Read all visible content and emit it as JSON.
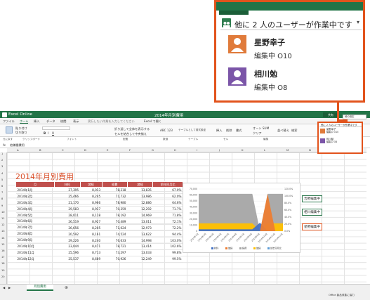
{
  "app": {
    "name": "Excel Online",
    "doc_title": "2014年月別費用",
    "tell_me": "実行したい作業を入力してください",
    "open_excel": "Excel で開く",
    "share": "共有"
  },
  "tabs": [
    "ファイル",
    "ホーム",
    "挿入",
    "データ",
    "校閲",
    "表示"
  ],
  "ribbon_groups": [
    "元に戻す",
    "クリップボード",
    "フォント",
    "配置",
    "数値",
    "テーブル",
    "セル",
    "編集"
  ],
  "ribbon_buttons": {
    "paste": "貼り付け",
    "cut": "切り取り",
    "copy": "コピー",
    "wrap": "折り返して全体を表示する",
    "merge": "セルを結合して中央揃え",
    "number": "ABC 123",
    "table_format": "テーブルとして書式設定",
    "insert": "挿入",
    "delete": "削除",
    "format": "書式",
    "autosum": "オート SUM",
    "clear": "クリア",
    "sort": "並べ替え",
    "find": "検索"
  },
  "formula_bar": {
    "fx": "fx",
    "content": "他職種費用"
  },
  "columns": [
    "A",
    "B",
    "C",
    "D",
    "E",
    "F",
    "G",
    "H",
    "I",
    "J",
    "K",
    "L",
    "M",
    "N",
    "O",
    "P",
    "Q"
  ],
  "rows": [
    "1",
    "2",
    "3",
    "4",
    "5",
    "6",
    "7",
    "8",
    "9",
    "10",
    "11",
    "12",
    "13",
    "14",
    "15",
    "16",
    "17",
    "18",
    "19",
    "20"
  ],
  "sheet": {
    "title": "2014年月別費用",
    "headers": [
      "月",
      "材料",
      "諸経",
      "経費",
      "諸経",
      "前年同月比"
    ],
    "rows": [
      [
        "2014年1月",
        "27,395",
        "8,013",
        "78,218",
        "13,835",
        "67.0%"
      ],
      [
        "2014年2月",
        "25,466",
        "8,245",
        "71,732",
        "13,986",
        "62.0%"
      ],
      [
        "2014年3月",
        "21,170",
        "8,966",
        "78,980",
        "12,886",
        "64.6%"
      ],
      [
        "2014年4月",
        "29,583",
        "8,937",
        "70,359",
        "12,292",
        "71.7%"
      ],
      [
        "2014年5月",
        "28,011",
        "8,118",
        "78,192",
        "14,969",
        "71.8%"
      ],
      [
        "2014年6月",
        "26,519",
        "8,927",
        "70,489",
        "13,011",
        "72.1%"
      ],
      [
        "2014年7月",
        "26,656",
        "8,205",
        "71,024",
        "12,973",
        "72.2%"
      ],
      [
        "2014年8月",
        "20,592",
        "8,161",
        "74,524",
        "13,622",
        "94.4%"
      ],
      [
        "2014年9月",
        "29,226",
        "8,240",
        "76,633",
        "14,998",
        "103.0%"
      ],
      [
        "2014年10月",
        "23,044",
        "8,471",
        "78,721",
        "13,414",
        "102.6%"
      ],
      [
        "2014年11月",
        "25,596",
        "8,713",
        "73,297",
        "13,033",
        "99.8%"
      ],
      [
        "2014年12月",
        "25,537",
        "8,689",
        "70,926",
        "12,249",
        "99.5%"
      ]
    ]
  },
  "chart_data": {
    "type": "area",
    "categories": [
      "2014年1月",
      "2014年2月",
      "2014年3月",
      "2014年4月",
      "2014年5月",
      "2014年6月",
      "2014年7月",
      "2014年8月",
      "2014年9月",
      "2014年10月",
      "2014年11月",
      "2014年12月"
    ],
    "y_ticks": [
      "0",
      "10,000",
      "20,000",
      "30,000",
      "40,000",
      "50,000",
      "60,000",
      "70,000"
    ],
    "y2_ticks": [
      "0.0%",
      "20.0%",
      "40.0%",
      "60.0%",
      "80.0%",
      "100.0%",
      "120.0%"
    ],
    "ylim": [
      0,
      70000
    ],
    "legend": [
      "材料",
      "諸経",
      "経費",
      "諸経",
      "前年同月比"
    ],
    "series": [
      {
        "name": "経費",
        "color": "#a5a5a5",
        "values": [
          62000,
          62000,
          62000,
          62000,
          62000,
          62000,
          62000,
          62000,
          0,
          62000,
          62000,
          62000
        ]
      },
      {
        "name": "諸経",
        "color": "#ffc000",
        "values": [
          13000,
          13000,
          13000,
          13000,
          13000,
          13000,
          13000,
          13000,
          0,
          13000,
          13000,
          13000
        ]
      },
      {
        "name": "材料",
        "color": "#4472c4",
        "values": [
          3000,
          3000,
          3000,
          3000,
          3000,
          3000,
          3000,
          3000,
          14000,
          0,
          0,
          0
        ]
      },
      {
        "name": "前年同月比",
        "color": "#ed7d31",
        "values": [
          0,
          0,
          0,
          0,
          0,
          0,
          0,
          0,
          0,
          62000,
          0,
          0
        ]
      }
    ],
    "legend_position": "bottom"
  },
  "callouts": [
    "吉野編集中",
    "相川編集中",
    "星野編集中"
  ],
  "presence": {
    "header": "他に 2 人のユーザーが作業中です",
    "users": [
      {
        "name": "星野幸子",
        "status": "編集中 O10",
        "color": "#e07b3b"
      },
      {
        "name": "相川勉",
        "status": "編集中 O8",
        "color": "#7b55a8"
      }
    ],
    "small_header": "他に 2 人のユーザーが作業中です",
    "small_button": "他の設定"
  },
  "sheet_tab": "月別費用",
  "status": "Office 製品改善に協力"
}
